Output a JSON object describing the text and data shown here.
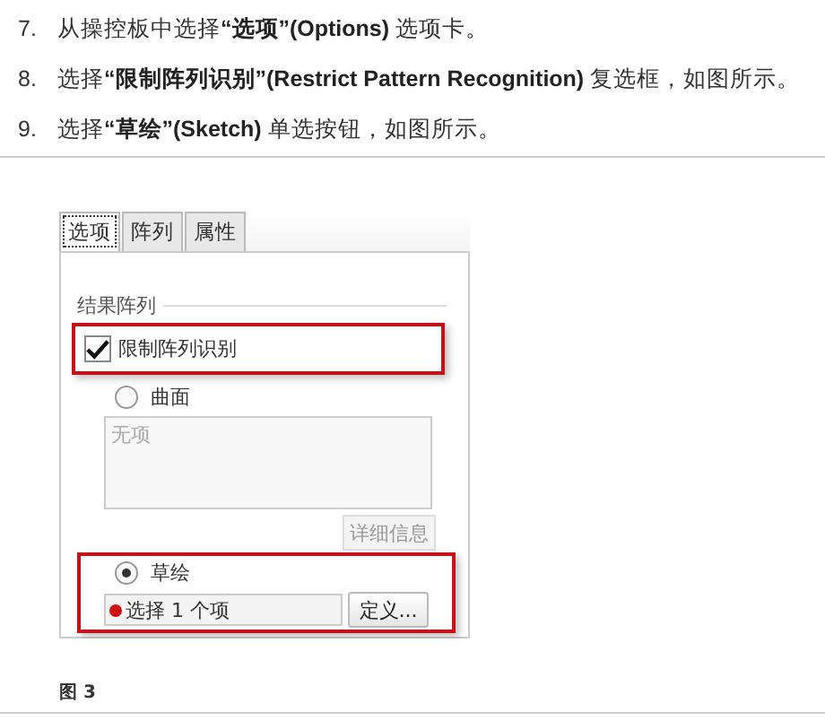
{
  "steps": [
    {
      "number": "7.",
      "text": "从操控板中选择**“选项”(Options)** 选项卡。"
    },
    {
      "number": "8.",
      "text": "选择**“限制阵列识别”(Restrict Pattern Recognition)** 复选框，如图所示。"
    },
    {
      "number": "9.",
      "text": "选择**“草绘”(Sketch)** 单选按钮，如图所示。"
    }
  ],
  "panel": {
    "tabs": [
      {
        "label": "选项",
        "selected": true
      },
      {
        "label": "阵列",
        "selected": false
      },
      {
        "label": "属性",
        "selected": false
      }
    ],
    "section_title": "结果阵列",
    "checkbox": {
      "label": "限制阵列识别",
      "checked": true,
      "highlighted": true
    },
    "surface_radio": {
      "label": "曲面",
      "selected": false
    },
    "item_list": {
      "placeholder": "无项"
    },
    "details_button": {
      "label": "详细信息",
      "disabled": true
    },
    "sketch_group": {
      "highlighted": true,
      "radio": {
        "label": "草绘",
        "selected": true
      },
      "collector": {
        "text": "选择 1 个项",
        "color": "#d01010"
      },
      "define_button": {
        "label": "定义..."
      }
    }
  },
  "caption": "图 3"
}
